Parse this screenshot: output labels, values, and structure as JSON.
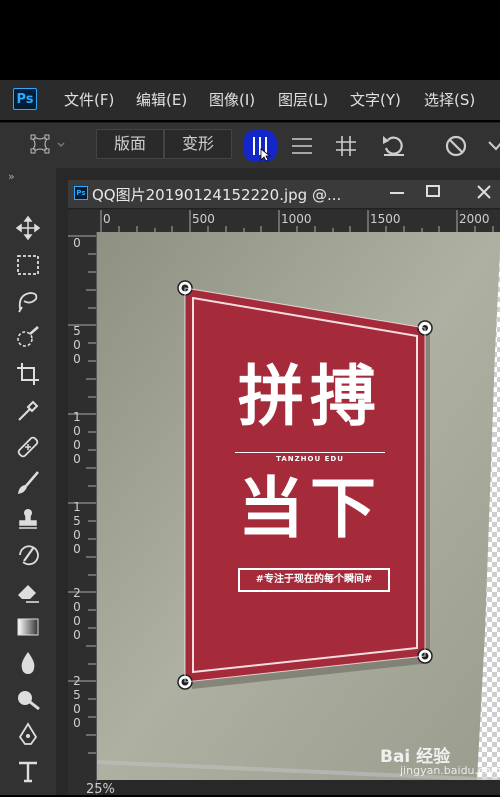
{
  "app": {
    "logo": "Ps"
  },
  "menu": [
    "文件(F)",
    "编辑(E)",
    "图像(I)",
    "图层(L)",
    "文字(Y)",
    "选择(S)"
  ],
  "options": {
    "segments": [
      "版面",
      "变形"
    ],
    "icons": [
      "puppet-warp-icon",
      "vertical-split-icon",
      "horizontal-split-icon",
      "grid-split-icon",
      "undo-icon",
      "cancel-icon",
      "commit-icon"
    ]
  },
  "document": {
    "title": "QQ图片20190124152220.jpg @...",
    "ruler_h": [
      "0",
      "500",
      "1000",
      "1500",
      "2000"
    ],
    "ruler_v": [
      "0",
      "500",
      "1000",
      "1500",
      "2000",
      "2500"
    ],
    "zoom": "25%"
  },
  "poster": {
    "headline_top": "拼搏",
    "brand": "TANZHOU EDU",
    "headline_bottom": "当下",
    "slogan": "#专注于现在的每个瞬间#",
    "color": "#a52a3a"
  },
  "tools": [
    "move-icon",
    "marquee-icon",
    "lasso-icon",
    "quick-select-icon",
    "crop-icon",
    "eyedropper-icon",
    "healing-brush-icon",
    "brush-icon",
    "stamp-icon",
    "history-brush-icon",
    "eraser-icon",
    "gradient-icon",
    "blur-icon",
    "dodge-icon",
    "pen-icon",
    "type-icon"
  ],
  "watermark": {
    "text": "Bai 经验",
    "sub": "jingyan.baidu.com"
  }
}
